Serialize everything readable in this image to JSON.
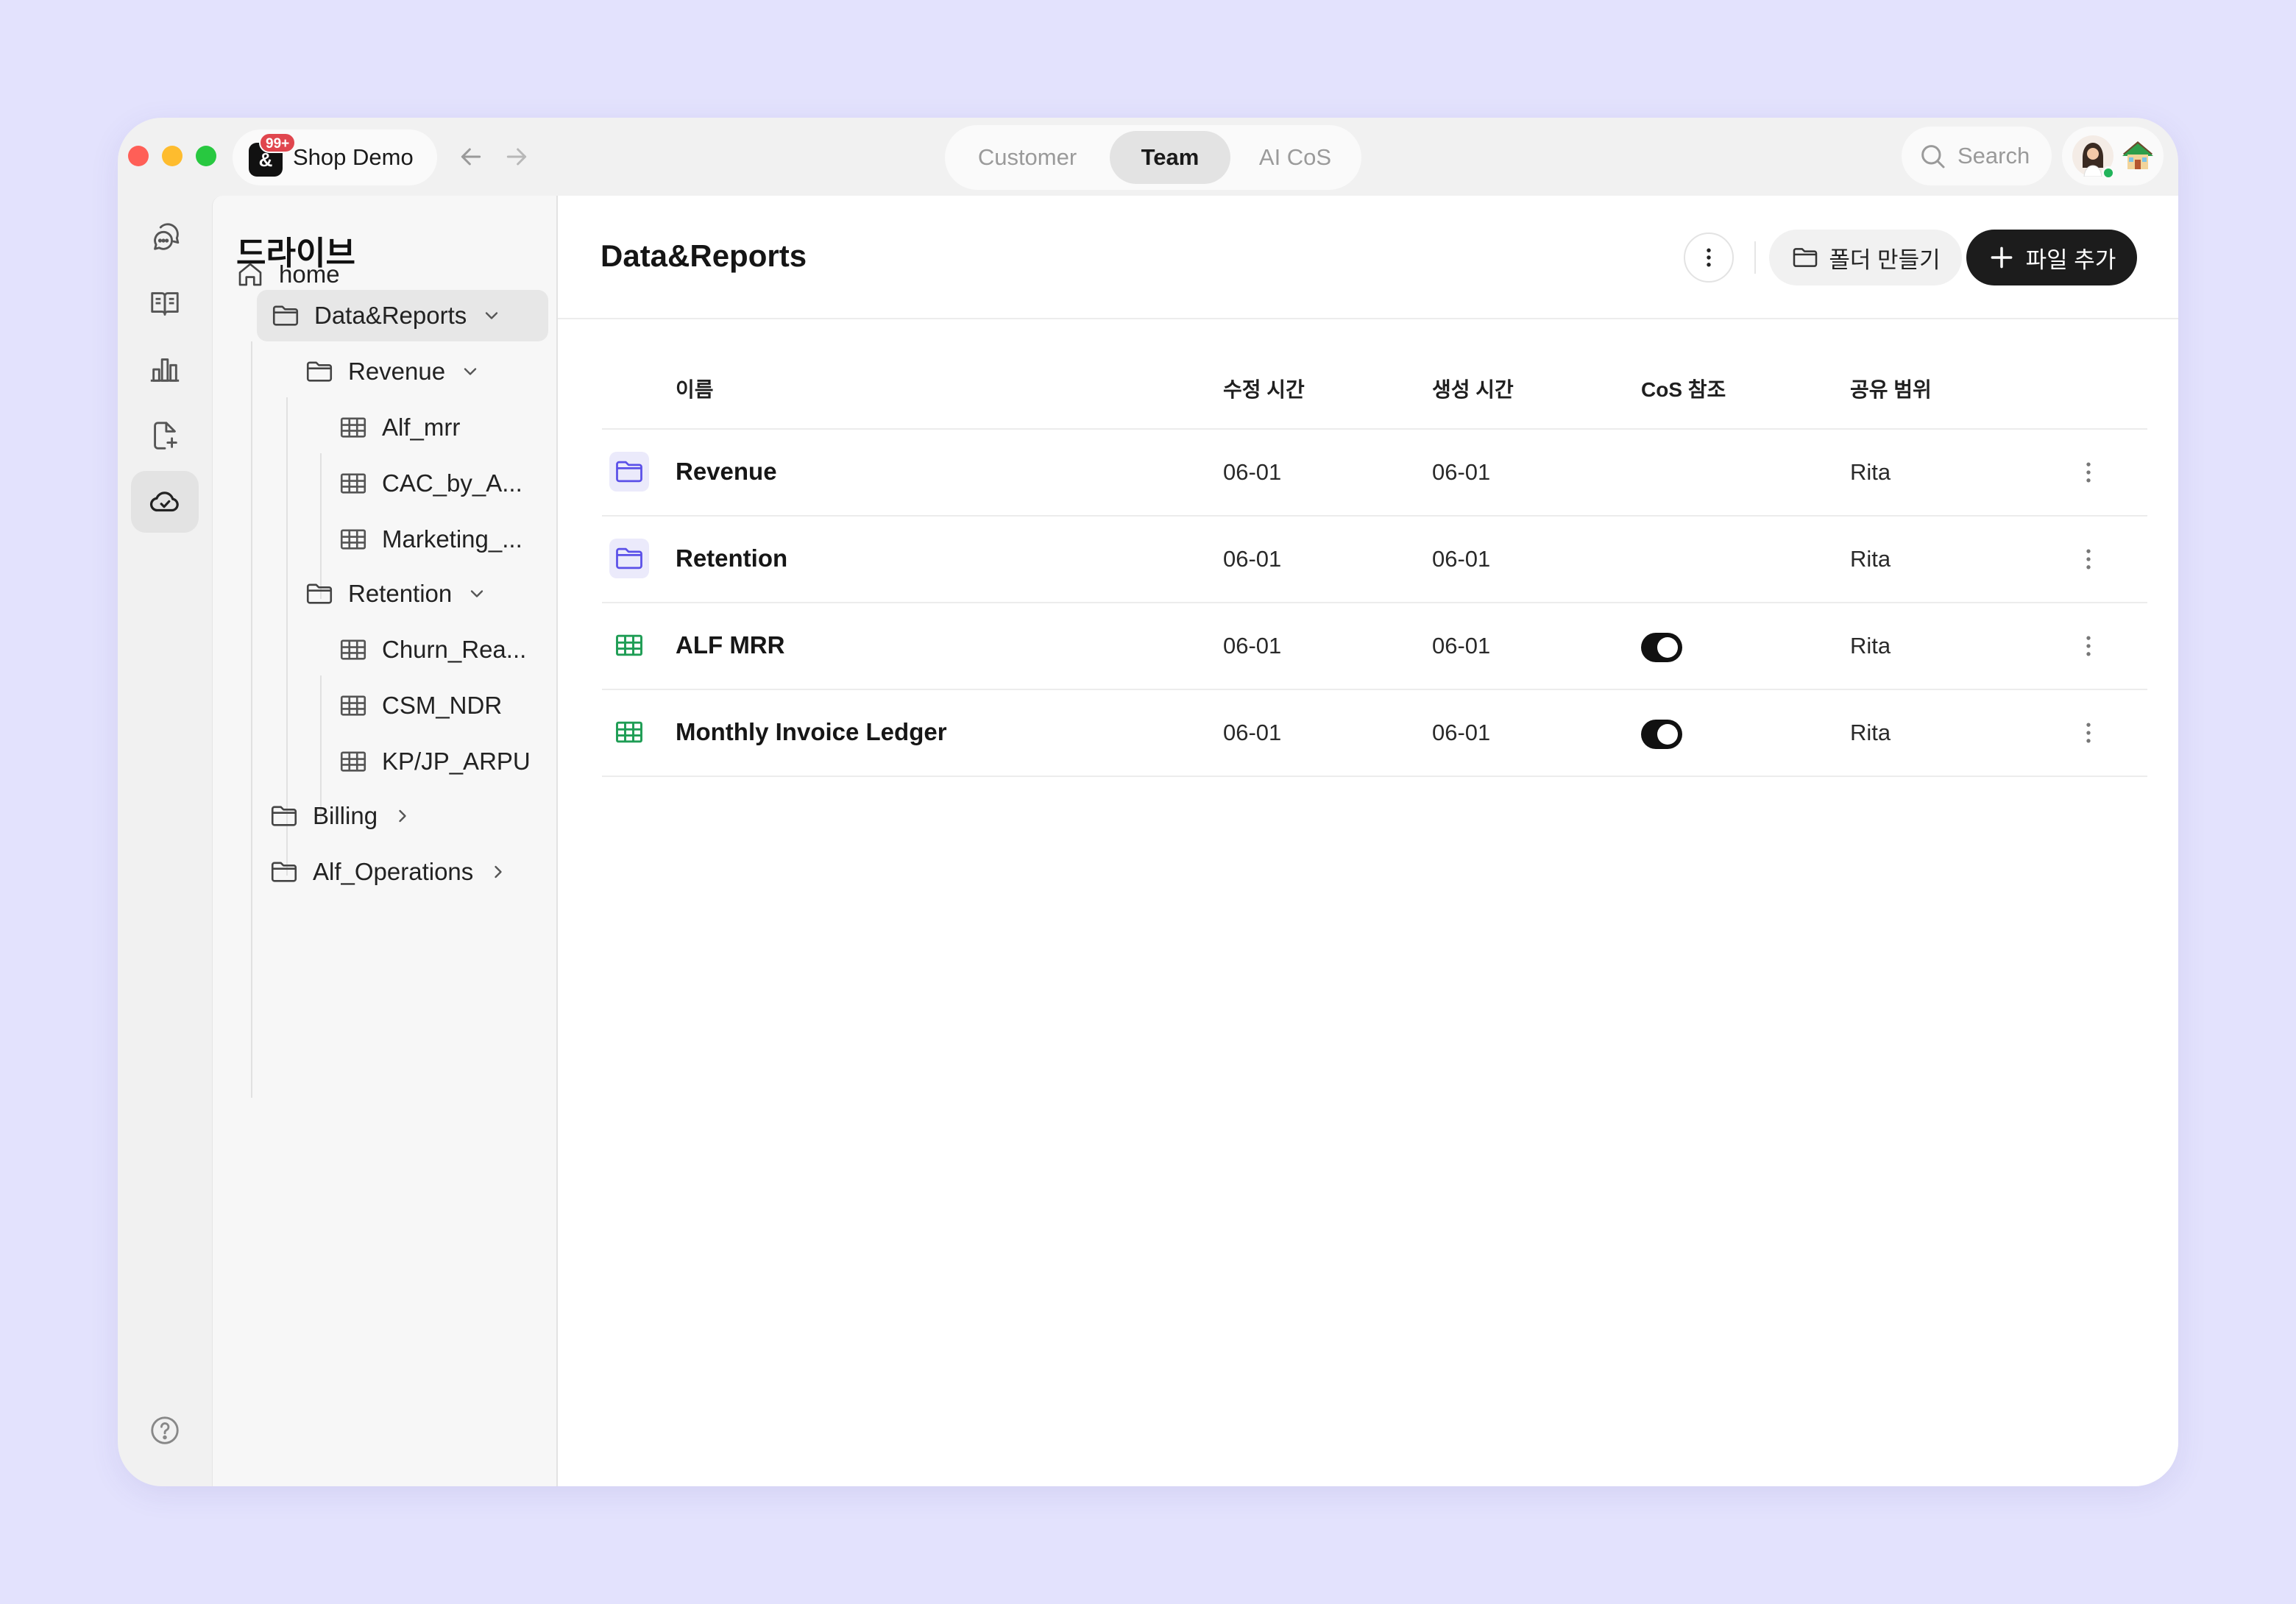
{
  "titlebar": {
    "workspace": {
      "name": "Shop Demo",
      "badge": "99+",
      "logo_glyph": "&"
    },
    "tabs": [
      {
        "label": "Customer",
        "active": false
      },
      {
        "label": "Team",
        "active": true
      },
      {
        "label": "AI CoS",
        "active": false
      }
    ],
    "search": {
      "placeholder": "Search"
    }
  },
  "rail": {
    "items": [
      {
        "icon": "chat-icon",
        "active": false
      },
      {
        "icon": "book-icon",
        "active": false
      },
      {
        "icon": "bar-chart-icon",
        "active": false
      },
      {
        "icon": "file-add-icon",
        "active": false
      },
      {
        "icon": "cloud-check-icon",
        "active": true
      }
    ],
    "help_icon": "help-icon"
  },
  "sidebar": {
    "title": "드라이브",
    "tree": [
      {
        "label": "home",
        "icon": "home-icon"
      },
      {
        "label": "Data&Reports",
        "icon": "folder-icon",
        "chevron": "down",
        "selected": true
      },
      {
        "label": "Revenue",
        "icon": "folder-icon",
        "chevron": "down"
      },
      {
        "label": "Alf_mrr",
        "icon": "table-icon"
      },
      {
        "label": "CAC_by_A...",
        "icon": "table-icon"
      },
      {
        "label": "Marketing_...",
        "icon": "table-icon"
      },
      {
        "label": "Retention",
        "icon": "folder-icon",
        "chevron": "down"
      },
      {
        "label": "Churn_Rea...",
        "icon": "table-icon"
      },
      {
        "label": "CSM_NDR",
        "icon": "table-icon"
      },
      {
        "label": "KP/JP_ARPU",
        "icon": "table-icon"
      },
      {
        "label": "Billing",
        "icon": "folder-icon",
        "chevron": "right"
      },
      {
        "label": "Alf_Operations",
        "icon": "folder-icon",
        "chevron": "right"
      }
    ]
  },
  "main": {
    "title": "Data&Reports",
    "new_folder_label": "폴더 만들기",
    "add_file_label": "파일 추가",
    "columns": [
      "이름",
      "수정 시간",
      "생성 시간",
      "CoS 참조",
      "공유 범위"
    ],
    "rows": [
      {
        "type": "folder",
        "name": "Revenue",
        "modified": "06-01",
        "created": "06-01",
        "cos_ref": null,
        "shared": "Rita"
      },
      {
        "type": "folder",
        "name": "Retention",
        "modified": "06-01",
        "created": "06-01",
        "cos_ref": null,
        "shared": "Rita"
      },
      {
        "type": "sheet",
        "name": "ALF MRR",
        "modified": "06-01",
        "created": "06-01",
        "cos_ref": true,
        "shared": "Rita"
      },
      {
        "type": "sheet",
        "name": "Monthly Invoice Ledger",
        "modified": "06-01",
        "created": "06-01",
        "cos_ref": true,
        "shared": "Rita"
      }
    ]
  },
  "colors": {
    "background": "#e3e2fd",
    "folder_accent": "#5b50e8",
    "sheet_accent": "#1f9d55",
    "primary_button": "#1c1c1c",
    "badge": "#e0464e",
    "online_dot": "#21b35a"
  }
}
